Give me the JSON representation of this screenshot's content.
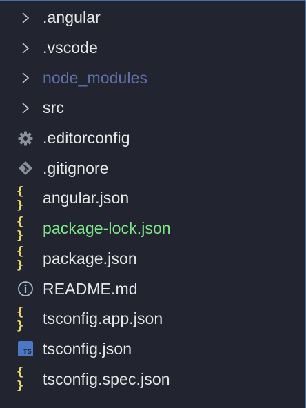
{
  "explorer": {
    "items": [
      {
        "type": "folder",
        "label": ".angular"
      },
      {
        "type": "folder",
        "label": ".vscode"
      },
      {
        "type": "folder",
        "label": "node_modules",
        "style": "dim"
      },
      {
        "type": "folder",
        "label": "src"
      },
      {
        "type": "gear",
        "label": ".editorconfig"
      },
      {
        "type": "git",
        "label": ".gitignore"
      },
      {
        "type": "json",
        "label": "angular.json"
      },
      {
        "type": "json",
        "label": "package-lock.json",
        "style": "green"
      },
      {
        "type": "json",
        "label": "package.json"
      },
      {
        "type": "info",
        "label": "README.md"
      },
      {
        "type": "json",
        "label": "tsconfig.app.json"
      },
      {
        "type": "ts",
        "label": "tsconfig.json"
      },
      {
        "type": "json",
        "label": "tsconfig.spec.json"
      }
    ],
    "icon_glyphs": {
      "json": "{ }",
      "ts": "TS"
    },
    "colors": {
      "background": "#22252f",
      "text": "#e6e6e6",
      "ignored": "#5f6fa8",
      "modified": "#7ee787",
      "json_icon": "#e6d96a",
      "ts_icon": "#4a78c4",
      "gear_icon": "#8a8f99",
      "git_icon": "#8a8f99",
      "info_icon": "#a9b7d6"
    }
  }
}
